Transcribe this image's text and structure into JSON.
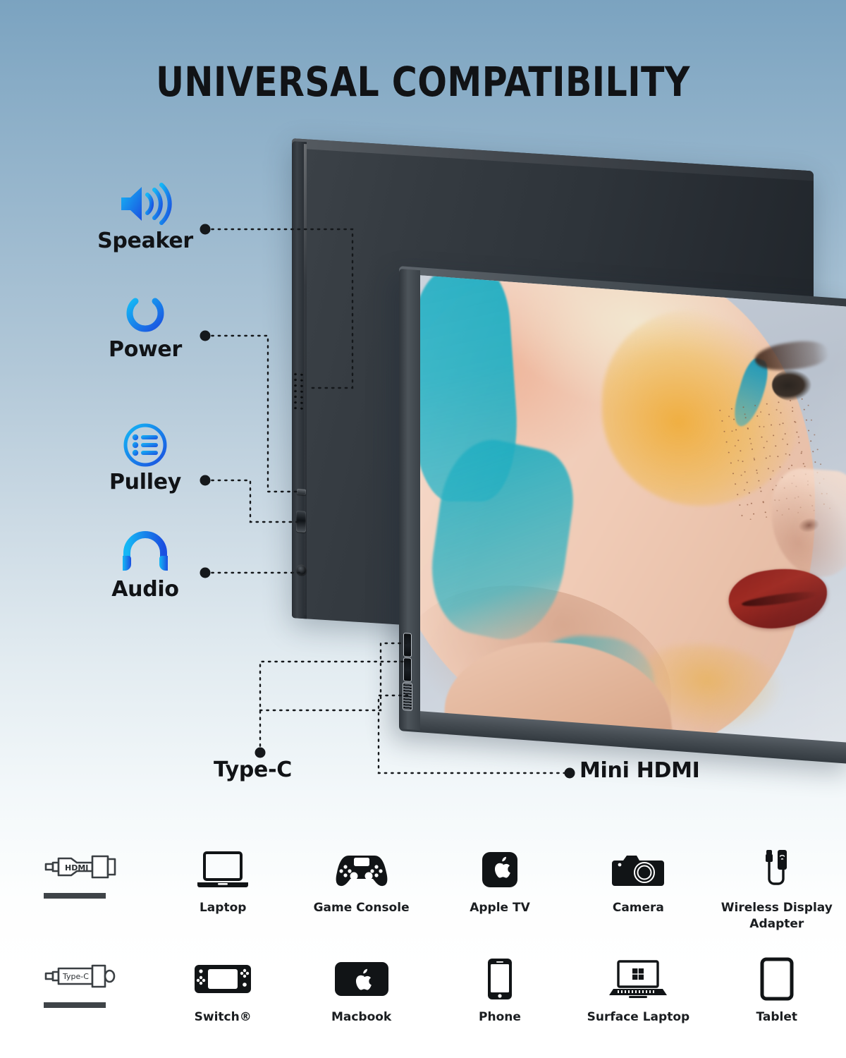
{
  "title": "UNIVERSAL COMPATIBILITY",
  "colors": {
    "background_top": "#7ba3c0",
    "background_bottom": "#ffffff",
    "icon_gradient_start": "#15b7f5",
    "icon_gradient_end": "#1b4fe0",
    "text": "#111316",
    "connector_bar": "#3f4448"
  },
  "features": [
    {
      "label": "Speaker",
      "icon": "speaker-icon"
    },
    {
      "label": "Power",
      "icon": "power-icon"
    },
    {
      "label": "Pulley",
      "icon": "menu-list-icon"
    },
    {
      "label": "Audio",
      "icon": "headphone-icon"
    }
  ],
  "port_labels": [
    {
      "label": "Type-C",
      "icon": "usb-c-port"
    },
    {
      "label": "Mini HDMI",
      "icon": "mini-hdmi-port"
    }
  ],
  "product": {
    "screen_content": "beauty model profile portrait with teal face paint, orange eyeshadow and dark red lips"
  },
  "compatibility": {
    "rows": [
      {
        "connector": {
          "label": "HDMI",
          "icon": "hdmi-connector-icon"
        },
        "devices": [
          {
            "label": "Laptop",
            "icon": "laptop-icon"
          },
          {
            "label": "Game Console",
            "icon": "gamepad-icon"
          },
          {
            "label": "Apple TV",
            "icon": "apple-tv-icon"
          },
          {
            "label": "Camera",
            "icon": "camera-icon"
          },
          {
            "label": "Wireless Display Adapter",
            "icon": "wireless-display-adapter-icon"
          }
        ]
      },
      {
        "connector": {
          "label": "Type-C",
          "icon": "type-c-connector-icon"
        },
        "devices": [
          {
            "label": "Switch®",
            "icon": "nintendo-switch-icon"
          },
          {
            "label": "Macbook",
            "icon": "macbook-icon"
          },
          {
            "label": "Phone",
            "icon": "phone-icon"
          },
          {
            "label": "Surface Laptop",
            "icon": "surface-laptop-icon"
          },
          {
            "label": "Tablet",
            "icon": "tablet-icon"
          }
        ]
      }
    ]
  }
}
